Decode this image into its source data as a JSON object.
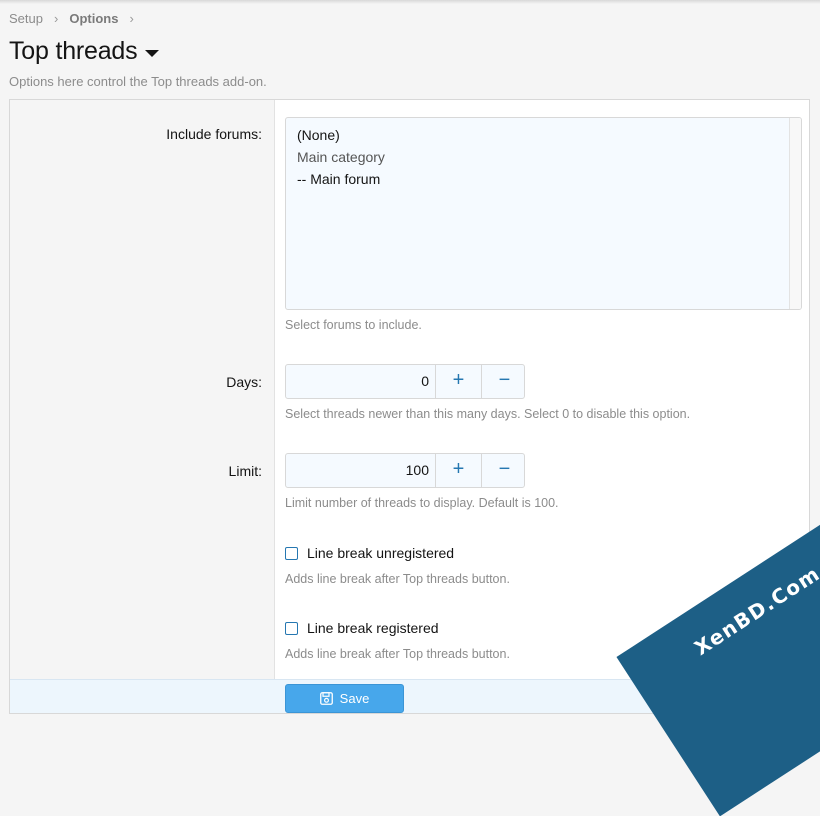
{
  "breadcrumb": {
    "items": [
      "Setup",
      "Options"
    ],
    "separator": "›"
  },
  "page": {
    "title": "Top threads",
    "description": "Options here control the Top threads add-on."
  },
  "fields": {
    "include_forums": {
      "label": "Include forums:",
      "options": [
        "(None)",
        "Main category",
        "-- Main forum"
      ],
      "hint": "Select forums to include."
    },
    "days": {
      "label": "Days:",
      "value": "0",
      "increment_symbol": "+",
      "decrement_symbol": "−",
      "hint": "Select threads newer than this many days. Select 0 to disable this option."
    },
    "limit": {
      "label": "Limit:",
      "value": "100",
      "increment_symbol": "+",
      "decrement_symbol": "−",
      "hint": "Limit number of threads to display. Default is 100."
    },
    "line_break_unregistered": {
      "label": "Line break unregistered",
      "checked": false,
      "hint": "Adds line break after Top threads button."
    },
    "line_break_registered": {
      "label": "Line break registered",
      "checked": false,
      "hint": "Adds line break after Top threads button."
    }
  },
  "footer": {
    "save_label": "Save",
    "save_icon": "floppy-disk-icon"
  },
  "watermark": {
    "text": "XenBD.Com"
  },
  "colors": {
    "accent": "#2577b1",
    "button": "#47a7eb",
    "watermark": "#1d5f86"
  }
}
